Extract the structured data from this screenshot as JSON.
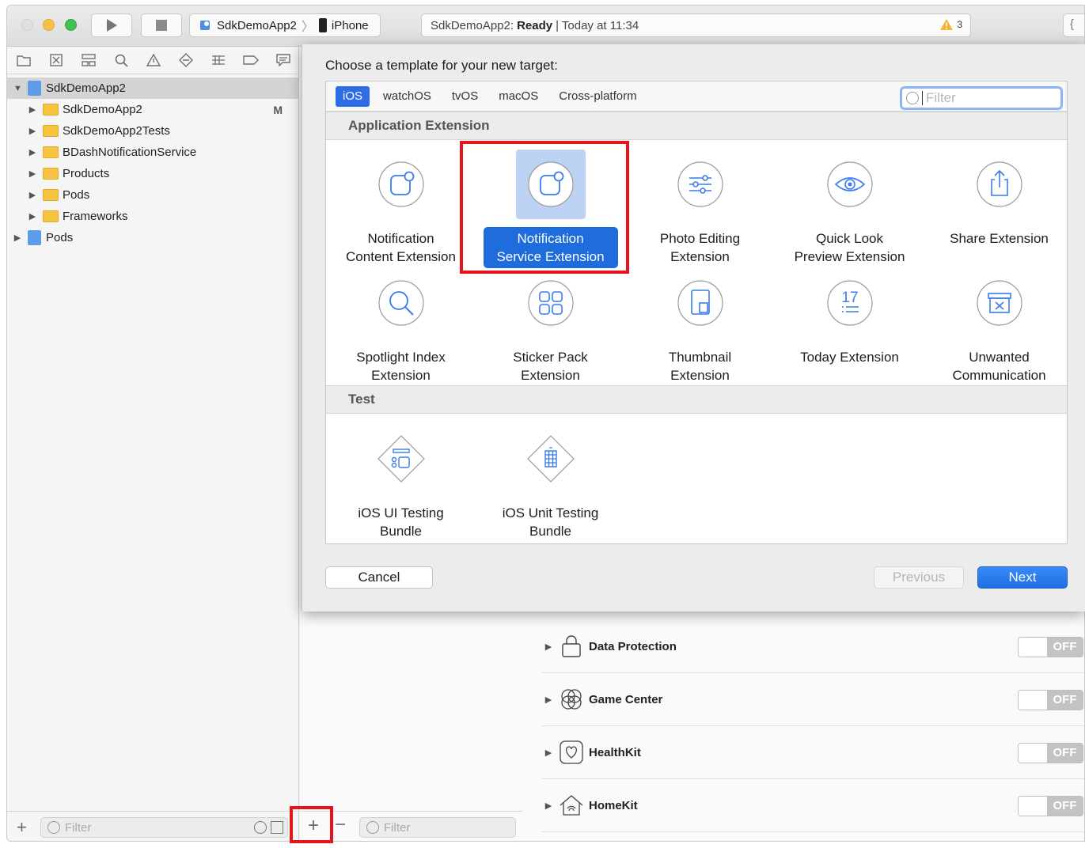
{
  "toolbar": {
    "scheme_app": "SdkDemoApp2",
    "scheme_device": "iPhone",
    "status_project": "SdkDemoApp2:",
    "status_state": "Ready",
    "status_time": "| Today at 11:34",
    "warning_count": "3"
  },
  "navigator": {
    "root": "SdkDemoApp2",
    "items": [
      {
        "label": "SdkDemoApp2",
        "badge": "M"
      },
      {
        "label": "SdkDemoApp2Tests",
        "badge": ""
      },
      {
        "label": "BDashNotificationService",
        "badge": ""
      },
      {
        "label": "Products",
        "badge": ""
      },
      {
        "label": "Pods",
        "badge": ""
      },
      {
        "label": "Frameworks",
        "badge": ""
      }
    ],
    "pods_project": "Pods",
    "filter_placeholder": "Filter"
  },
  "targets_filter_placeholder": "Filter",
  "sheet": {
    "title": "Choose a template for your new target:",
    "platforms": [
      "iOS",
      "watchOS",
      "tvOS",
      "macOS",
      "Cross-platform"
    ],
    "active_platform": "iOS",
    "filter_placeholder": "Filter",
    "sections": [
      {
        "title": "Application Extension",
        "templates": [
          "Notification\nContent Extension",
          "Notification\nService Extension",
          "Photo Editing\nExtension",
          "Quick Look\nPreview Extension",
          "Share Extension",
          "Spotlight Index\nExtension",
          "Sticker Pack\nExtension",
          "Thumbnail\nExtension",
          "Today Extension",
          "Unwanted\nCommunication"
        ]
      },
      {
        "title": "Test",
        "templates": [
          "iOS UI Testing\nBundle",
          "iOS Unit Testing\nBundle"
        ]
      }
    ],
    "selected_template": "Notification\nService Extension",
    "today_icon_number": "17",
    "buttons": {
      "cancel": "Cancel",
      "previous": "Previous",
      "next": "Next"
    }
  },
  "capabilities": [
    {
      "label": "Data Protection",
      "state": "OFF"
    },
    {
      "label": "Game Center",
      "state": "OFF"
    },
    {
      "label": "HealthKit",
      "state": "OFF"
    },
    {
      "label": "HomeKit",
      "state": "OFF"
    }
  ],
  "colors": {
    "accent": "#1f6cdc",
    "highlight_box": "#e4141c",
    "folder": "#f6c342"
  }
}
